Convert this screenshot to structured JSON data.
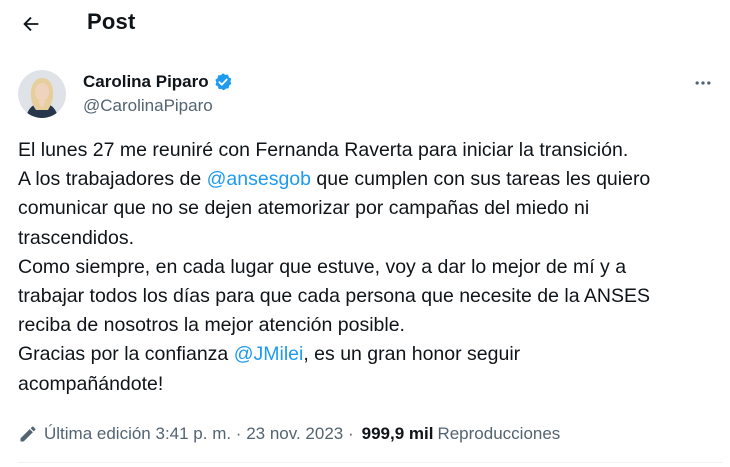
{
  "header": {
    "title": "Post"
  },
  "author": {
    "name": "Carolina Piparo",
    "handle": "@CarolinaPiparo"
  },
  "post": {
    "lines": [
      [
        {
          "t": "El lunes 27 me reuniré con Fernanda Raverta para iniciar la transición."
        }
      ],
      [
        {
          "t": "A los trabajadores de "
        },
        {
          "t": "@ansesgob",
          "mention": true
        },
        {
          "t": " que cumplen con sus tareas les quiero"
        }
      ],
      [
        {
          "t": "comunicar que no se dejen atemorizar por campañas del miedo ni"
        }
      ],
      [
        {
          "t": "trascendidos."
        }
      ],
      [
        {
          "t": "Como siempre, en cada lugar que estuve, voy a dar lo mejor de mí y a"
        }
      ],
      [
        {
          "t": "trabajar todos los días para que cada persona que necesite de la ANSES"
        }
      ],
      [
        {
          "t": "reciba de nosotros la mejor atención posible."
        }
      ],
      [
        {
          "t": "Gracias por la confianza "
        },
        {
          "t": "@JMilei",
          "mention": true
        },
        {
          "t": ", es un gran honor seguir"
        }
      ],
      [
        {
          "t": "acompañándote!"
        }
      ]
    ]
  },
  "meta": {
    "edited": "Última edición 3:41 p. m. · 23 nov. 2023 ·",
    "views_count": "999,9 mil",
    "views_label": "Reproducciones"
  },
  "colors": {
    "accent": "#1d9bf0",
    "muted": "#536471",
    "text": "#0f1419",
    "verified": "#1d9bf0"
  },
  "icons": {
    "back": "arrow-left-icon",
    "verified": "verified-badge-icon",
    "more": "more-horizontal-icon",
    "edit": "pencil-icon"
  }
}
